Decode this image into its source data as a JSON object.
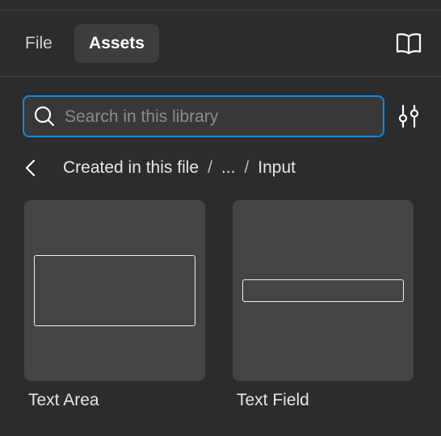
{
  "tabs": [
    {
      "label": "File",
      "active": false
    },
    {
      "label": "Assets",
      "active": true
    }
  ],
  "icons": {
    "library": "open-book-icon",
    "search": "search-icon",
    "filter": "sliders-icon",
    "back": "chevron-left-icon"
  },
  "search": {
    "placeholder": "Search in this library",
    "value": ""
  },
  "breadcrumb": {
    "items": [
      "Created in this file",
      "...",
      "Input"
    ],
    "separator": "/"
  },
  "components": [
    {
      "name": "Text Area"
    },
    {
      "name": "Text Field"
    }
  ],
  "colors": {
    "background": "#2c2c2c",
    "card": "#444444",
    "active_tab": "#3d3d3d",
    "focus_accent": "#0c8ce9",
    "text": "#ffffff"
  }
}
